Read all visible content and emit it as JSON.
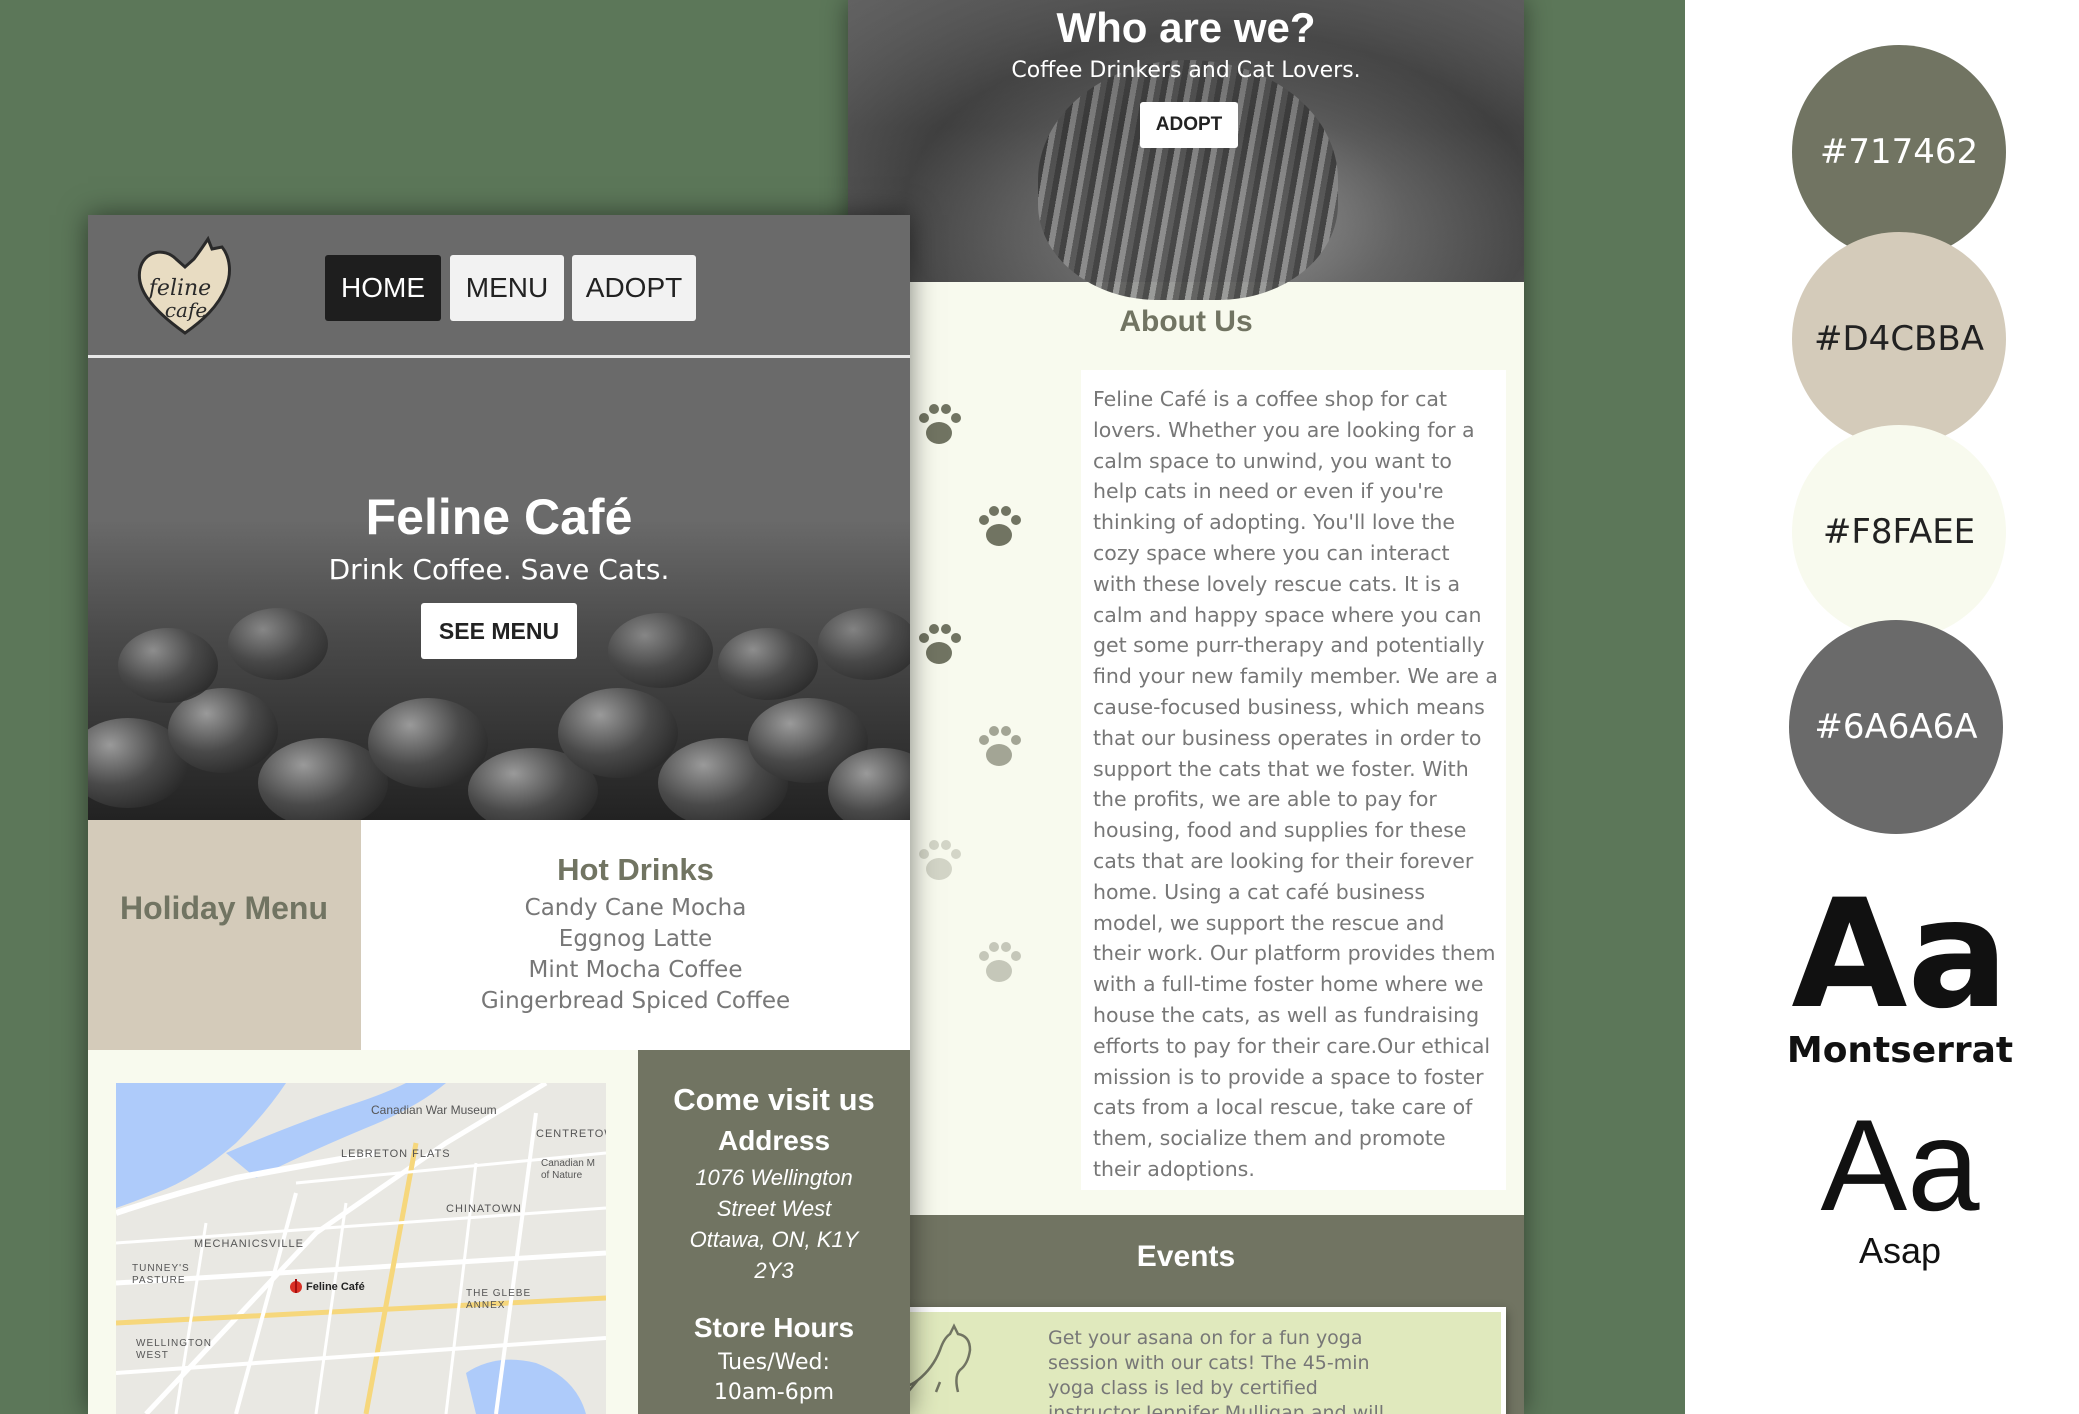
{
  "palette": [
    {
      "hex": "#717462",
      "label": "#717462",
      "text_color": "#ffffff"
    },
    {
      "hex": "#D4CBBA",
      "label": "#D4CBBA",
      "text_color": "#222222"
    },
    {
      "hex": "#F8FAEE",
      "label": "#F8FAEE",
      "text_color": "#222222"
    },
    {
      "hex": "#6A6A6A",
      "label": "#6A6A6A",
      "text_color": "#ffffff"
    }
  ],
  "fonts": {
    "sample": "Aa",
    "primary_name": "Montserrat",
    "secondary_name": "Asap"
  },
  "about_page": {
    "hero_title": "Who are we?",
    "hero_subtitle": "Coffee Drinkers and Cat Lovers.",
    "hero_button": "ADOPT",
    "about_title": "About Us",
    "about_text": "Feline Café is a coffee shop for cat lovers. Whether you are looking for a calm space to unwind, you want to help cats in need or even if you're thinking of adopting. You'll love the cozy space where you can interact with these lovely rescue cats. It is a calm and happy space where you can get some purr-therapy and potentially find your new family member. We are a cause-focused business, which means that our business operates in order to support the cats that we foster. With the profits, we are able to pay for housing, food and supplies for these cats that are looking for their forever home. Using a cat café business model, we support the rescue and their work. Our platform provides them with a full-time foster home where we house the cats, as well as fundraising efforts to pay for their care.Our ethical mission is to provide a space to foster cats from a local rescue, take care of them, socialize them and promote their adoptions.",
    "events_title": "Events",
    "event_text": "Get your asana on for a fun yoga session with our cats! The 45-min yoga class is led by certified instructor Jennifer Mulligan and will focus on a"
  },
  "home_page": {
    "logo_text_1": "feline",
    "logo_text_2": "cafe",
    "nav": [
      "HOME",
      "MENU",
      "ADOPT"
    ],
    "hero_title": "Feline Café",
    "hero_subtitle": "Drink Coffee. Save Cats.",
    "hero_button": "SEE MENU",
    "holiday_label": "Holiday Menu",
    "hot_drinks_title": "Hot Drinks",
    "hot_drinks": [
      "Candy Cane Mocha",
      "Eggnog Latte",
      "Mint Mocha Coffee",
      "Gingerbread Spiced Coffee"
    ],
    "visit_title": "Come visit us",
    "address_title": "Address",
    "address": "1076 Wellington Street West Ottawa, ON, K1Y 2Y3",
    "hours_title": "Store Hours",
    "hours_line1": "Tues/Wed:",
    "hours_line2": "10am-6pm",
    "map_labels": [
      "Canadian War Museum",
      "LEBRETON FLATS",
      "CENTRETOWN",
      "Canadian M of Nature",
      "CHINATOWN",
      "MECHANICSVILLE",
      "TUNNEY'S PASTURE",
      "Feline Café",
      "THE GLEBE ANNEX",
      "WELLINGTON WEST"
    ]
  }
}
